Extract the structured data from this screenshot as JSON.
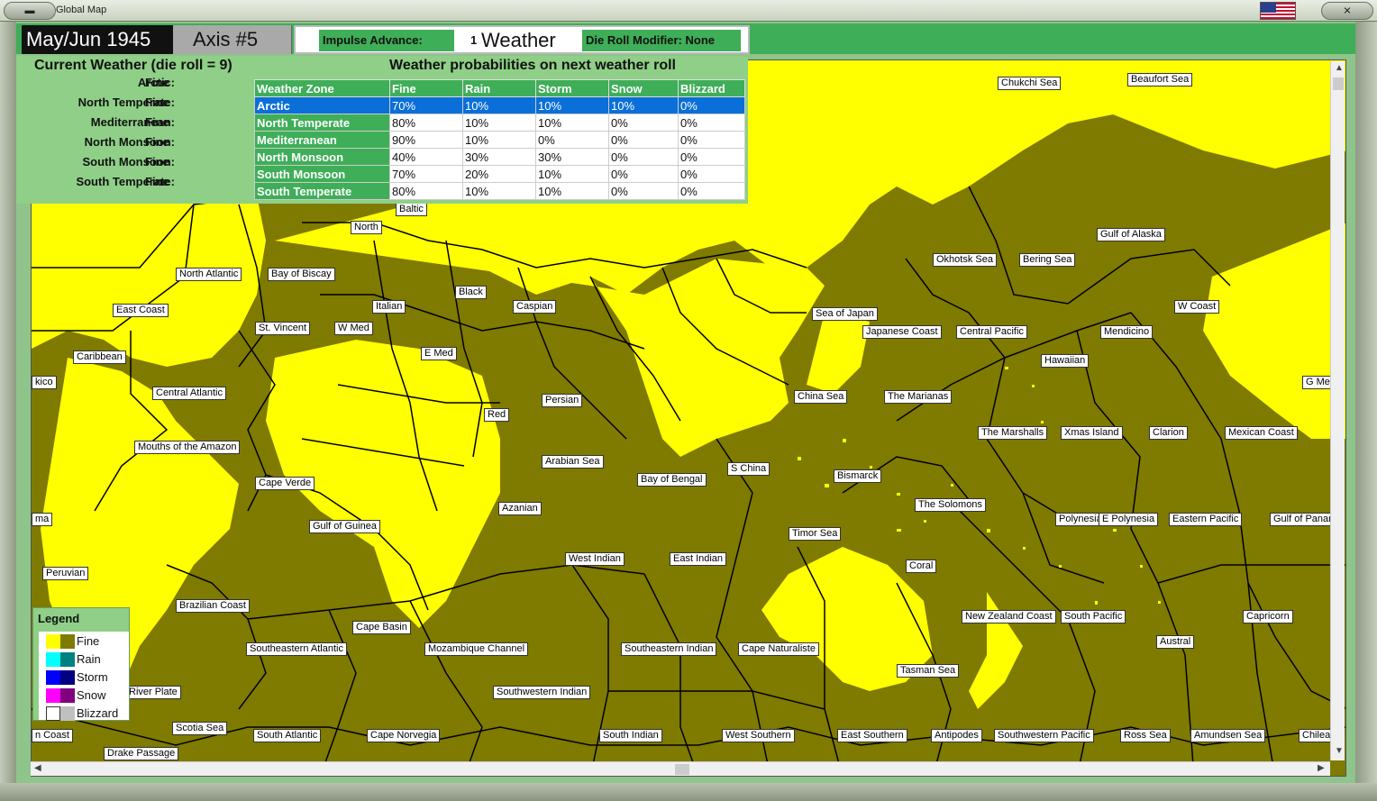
{
  "window": {
    "title": "Global Map"
  },
  "header": {
    "date": "May/Jun 1945",
    "turn": "Axis #5",
    "impulse_label": "Impulse Advance:",
    "impulse_value": "1",
    "screen": "Weather",
    "modifier_label": "Die Roll Modifier:",
    "modifier_value": "None"
  },
  "current_weather": {
    "title": "Current Weather (die roll = 9)",
    "zones": [
      {
        "name": "Arctic:",
        "value": "Fine"
      },
      {
        "name": "North Temperate:",
        "value": "Fine"
      },
      {
        "name": "Mediterranean:",
        "value": "Fine"
      },
      {
        "name": "North Monsoon:",
        "value": "Fine"
      },
      {
        "name": "South Monsoon:",
        "value": "Fine"
      },
      {
        "name": "South Temperate:",
        "value": "Fine"
      }
    ]
  },
  "probabilities": {
    "title": "Weather probabilities on next weather roll",
    "columns": [
      "Weather Zone",
      "Fine",
      "Rain",
      "Storm",
      "Snow",
      "Blizzard"
    ],
    "rows": [
      [
        "Arctic",
        "70%",
        "10%",
        "10%",
        "10%",
        "0%"
      ],
      [
        "North Temperate",
        "80%",
        "10%",
        "10%",
        "0%",
        "0%"
      ],
      [
        "Mediterranean",
        "90%",
        "10%",
        "0%",
        "0%",
        "0%"
      ],
      [
        "North Monsoon",
        "40%",
        "30%",
        "30%",
        "0%",
        "0%"
      ],
      [
        "South Monsoon",
        "70%",
        "20%",
        "10%",
        "0%",
        "0%"
      ],
      [
        "South Temperate",
        "80%",
        "10%",
        "10%",
        "0%",
        "0%"
      ]
    ]
  },
  "legend": {
    "title": "Legend",
    "items": [
      {
        "label": "Fine",
        "c1": "#ffff00",
        "c2": "#7f7a00"
      },
      {
        "label": "Rain",
        "c1": "#00ffff",
        "c2": "#008080"
      },
      {
        "label": "Storm",
        "c1": "#0000ff",
        "c2": "#000080"
      },
      {
        "label": "Snow",
        "c1": "#ff00ff",
        "c2": "#800080"
      },
      {
        "label": "Blizzard",
        "c1": "#ffffff",
        "c2": "#c0c0c0"
      }
    ]
  },
  "colors": {
    "land_fine": "#ffff00",
    "sea_fine": "#7f7a00",
    "panel": "#8fcf87",
    "accent": "#3fae58",
    "selection": "#0a6fd8"
  },
  "map_labels": [
    "Chukchi Sea",
    "Beaufort Sea",
    "Baltic",
    "North",
    "North Atlantic",
    "Bay of Biscay",
    "Black",
    "Italian",
    "Caspian",
    "East Coast",
    "St. Vincent",
    "W Med",
    "Sea of Japan",
    "Japanese Coast",
    "Central Pacific",
    "Mendicino",
    "W Coast",
    "Okhotsk Sea",
    "Bering Sea",
    "Gulf of Alaska",
    "Caribbean",
    "E Med",
    "Hawaiian",
    "kico",
    "Central Atlantic",
    "Persian",
    "China Sea",
    "The Marianas",
    "G Mex",
    "Red",
    "The Marshalls",
    "Xmas Island",
    "Clarion",
    "Mexican Coast",
    "Mouths of the Amazon",
    "Arabian Sea",
    "S China",
    "Bismarck",
    "Cape Verde",
    "Bay of Bengal",
    "The Solomons",
    "Azanian",
    "ma",
    "Gulf of Guinea",
    "Polynesia",
    "E Polynesia",
    "Eastern Pacific",
    "Gulf of Panar",
    "Timor Sea",
    "West Indian",
    "East Indian",
    "Peruvian",
    "Coral",
    "Brazilian Coast",
    "New Zealand Coast",
    "South Pacific",
    "Capricorn",
    "Cape Basin",
    "Austral",
    "Southeastern Atlantic",
    "Mozambique Channel",
    "Southeastern Indian",
    "Cape Naturaliste",
    "Tasman Sea",
    "Southwestern Indian",
    "River Plate",
    "Scotia Sea",
    "n Coast",
    "South Atlantic",
    "Cape Norvegia",
    "South Indian",
    "West Southern",
    "East Southern",
    "Antipodes",
    "Southwestern Pacific",
    "Ross Sea",
    "Amundsen Sea",
    "Chilear",
    "Drake Passage"
  ]
}
